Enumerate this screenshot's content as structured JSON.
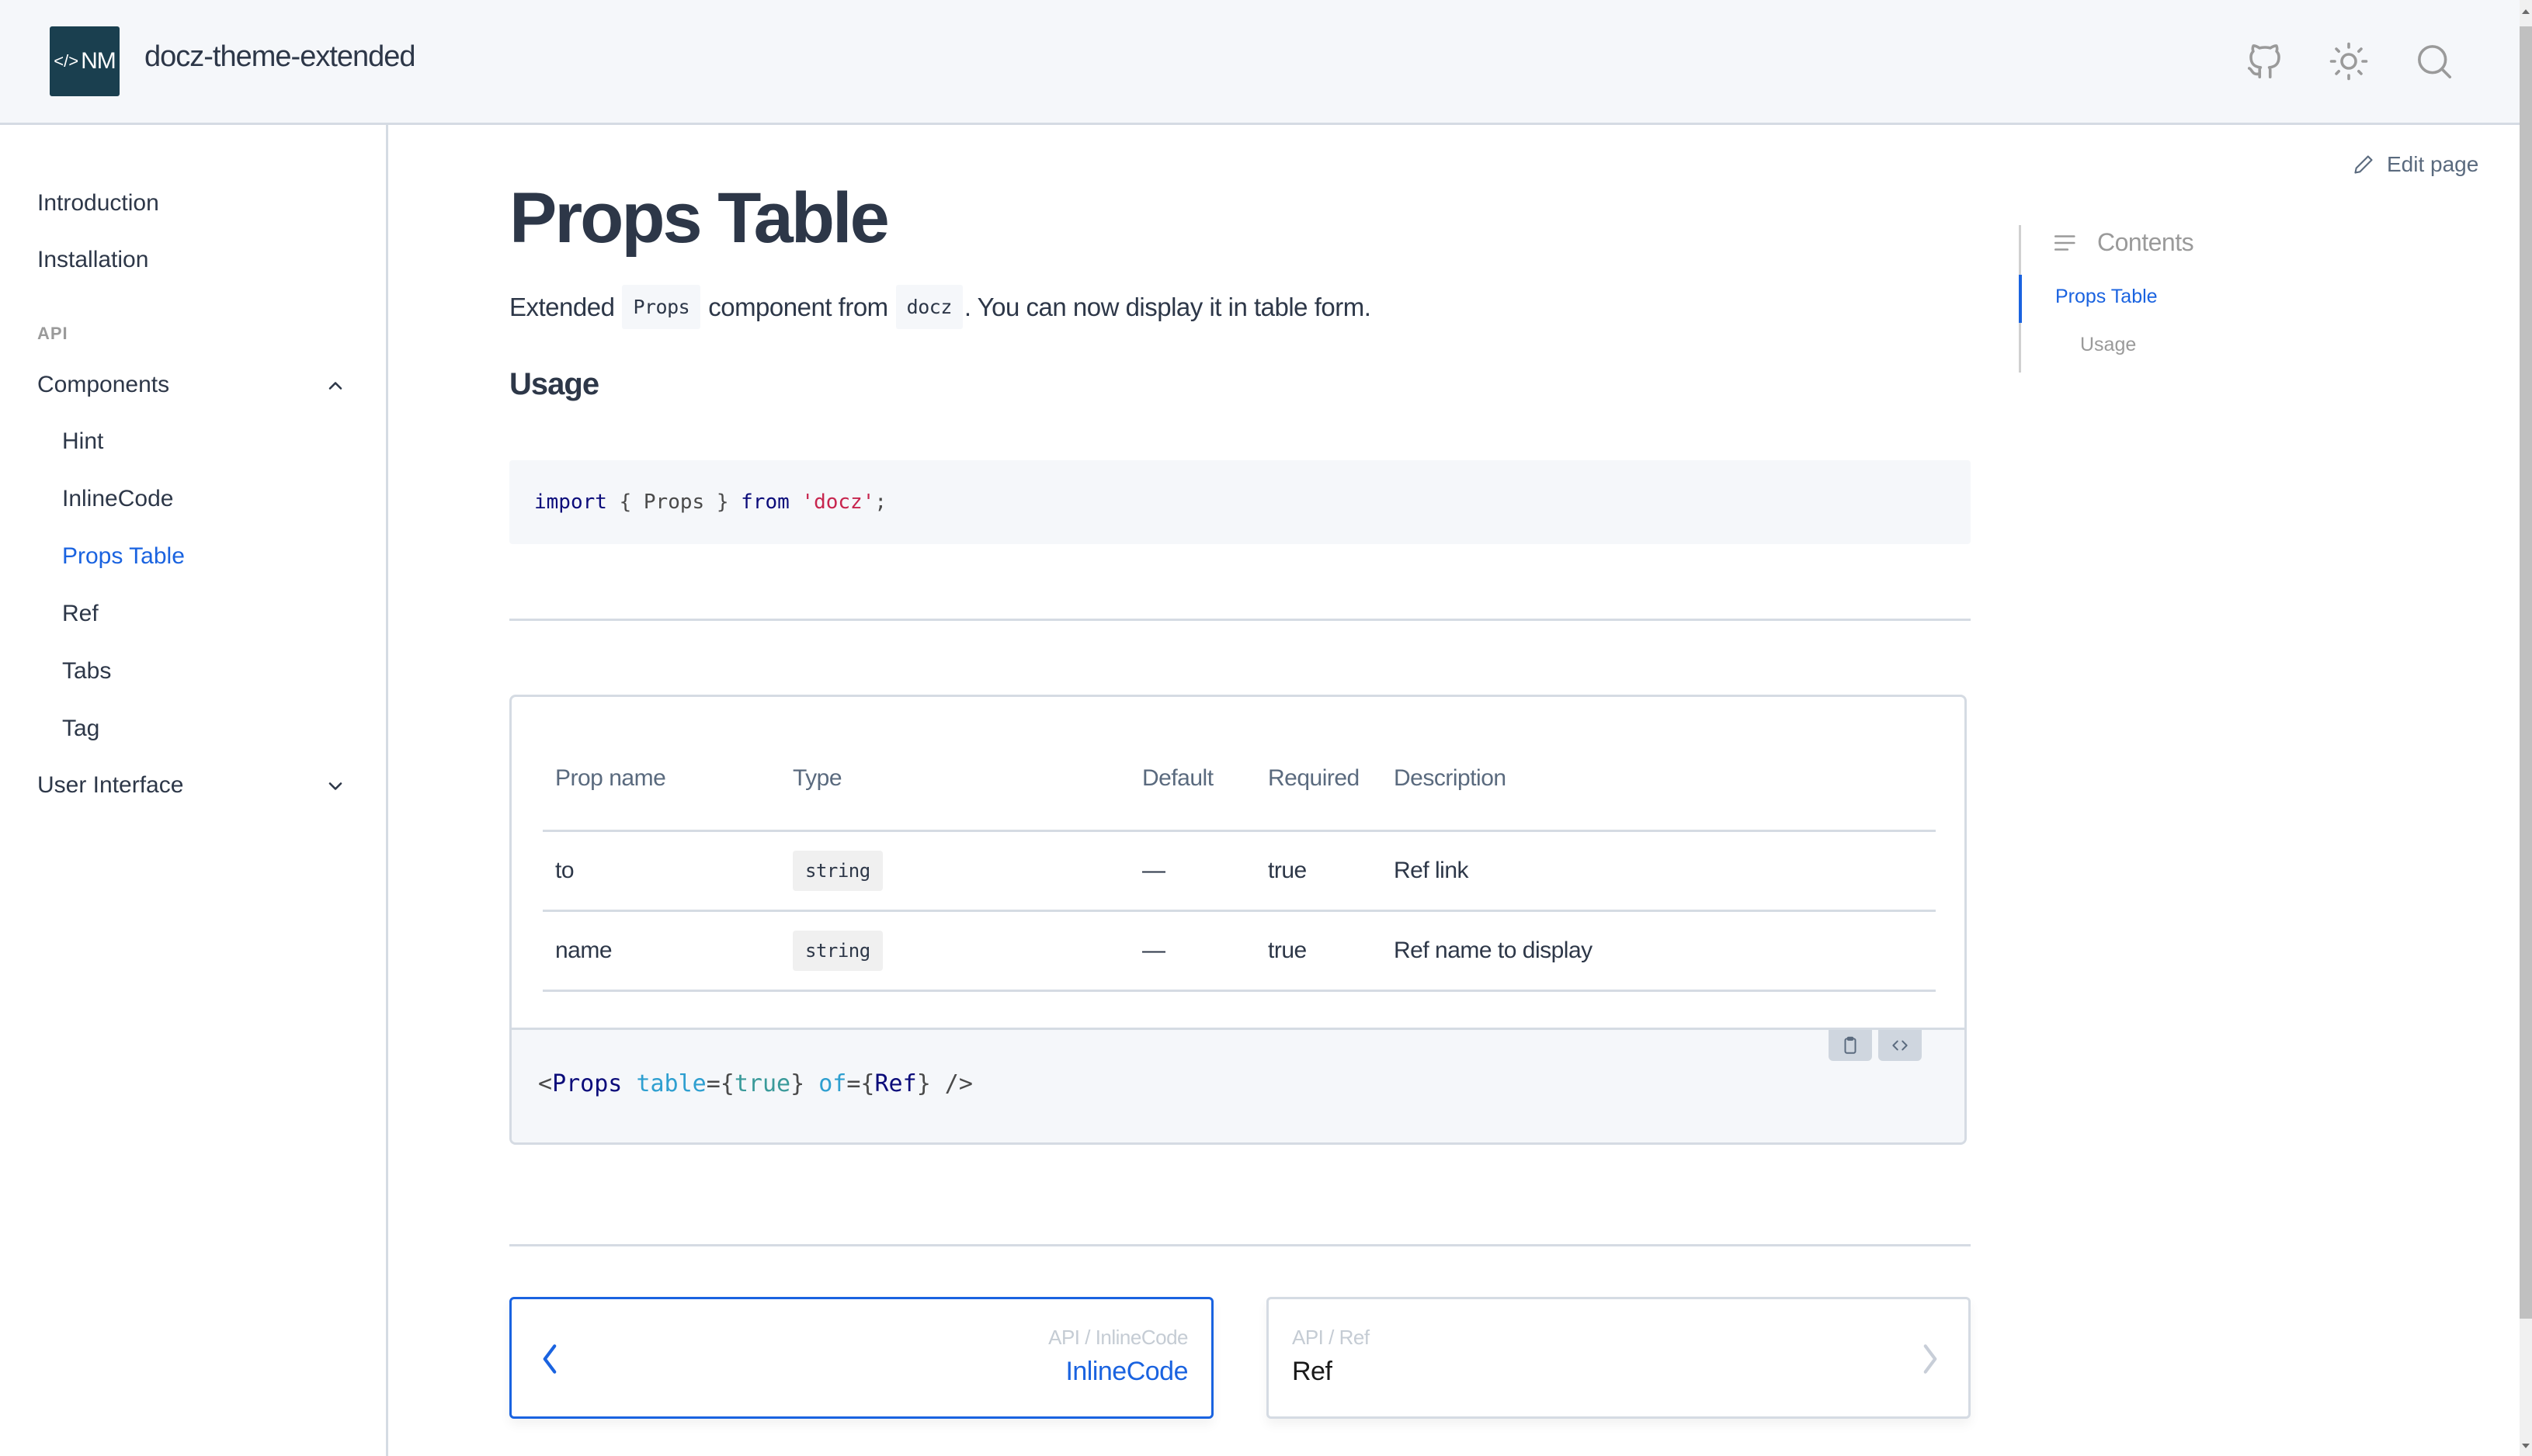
{
  "header": {
    "logo_text": "NM",
    "logo_bracket": "</>",
    "site_title": "docz-theme-extended",
    "icons": [
      "github-icon",
      "sun-icon",
      "search-icon"
    ],
    "logo_color": "#1a3f4f"
  },
  "sidebar": {
    "items": [
      {
        "label": "Introduction",
        "level": 0
      },
      {
        "label": "Installation",
        "level": 0
      }
    ],
    "section_label": "API",
    "groups": [
      {
        "label": "Components",
        "expanded": true,
        "children": [
          "Hint",
          "InlineCode",
          "Props Table",
          "Ref",
          "Tabs",
          "Tag"
        ],
        "active_child": "Props Table"
      },
      {
        "label": "User Interface",
        "expanded": false,
        "children": []
      }
    ],
    "accent_color": "#1a63e0"
  },
  "main": {
    "title": "Props Table",
    "lead": {
      "part1": "Extended",
      "code1": "Props",
      "part2": "component from",
      "code2": "docz",
      "part3": ". You can now display it in table form."
    },
    "usage_heading": "Usage",
    "import_code": {
      "kw_import": "import",
      "lbrace": " { ",
      "ident": "Props",
      "rbrace": " } ",
      "kw_from": "from",
      "space": " ",
      "string": "'docz'",
      "semi": ";"
    },
    "props_table": {
      "columns": [
        "Prop name",
        "Type",
        "Default",
        "Required",
        "Description"
      ],
      "rows": [
        {
          "name": "to",
          "type": "string",
          "default": "—",
          "required": "true",
          "description": "Ref link"
        },
        {
          "name": "name",
          "type": "string",
          "default": "—",
          "required": "true",
          "description": "Ref name to display"
        }
      ]
    },
    "editor": {
      "lt": "<",
      "tag": "Props",
      "attr1": "table",
      "eq1": "={",
      "val1": "true",
      "close1": "}",
      "attr2": "of",
      "eq2": "={",
      "val2": "Ref",
      "close2": "}",
      "end": " />",
      "copy_button": "clipboard-icon",
      "toggle_code_button": "code-icon"
    },
    "pagination": {
      "prev": {
        "crumb": "API / InlineCode",
        "title": "InlineCode"
      },
      "next": {
        "crumb": "API / Ref",
        "title": "Ref"
      }
    }
  },
  "edit_page_label": "Edit page",
  "toc": {
    "heading": "Contents",
    "items": [
      {
        "label": "Props Table",
        "active": true
      },
      {
        "label": "Usage",
        "active": false
      }
    ]
  }
}
